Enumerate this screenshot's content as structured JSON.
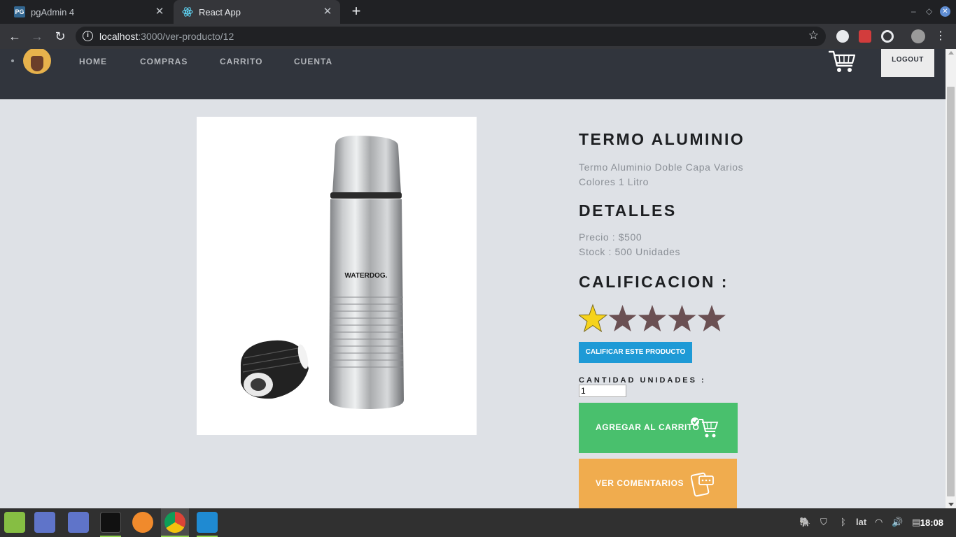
{
  "browser": {
    "tabs": [
      {
        "title": "pgAdmin 4",
        "favicon": "PG"
      },
      {
        "title": "React App",
        "favicon": "react-icon"
      }
    ],
    "new_tab": "+",
    "url_host": "localhost",
    "url_rest": ":3000/ver-producto/12"
  },
  "nav": {
    "links": [
      "HOME",
      "COMPRAS",
      "CARRITO",
      "CUENTA"
    ],
    "logout": "LOGOUT"
  },
  "product": {
    "title": "TERMO ALUMINIO",
    "description": "Termo Aluminio Doble Capa Varios Colores 1 Litro",
    "details_heading": "DETALLES",
    "price": "Precio : $500",
    "stock": "Stock : 500 Unidades",
    "rating_heading": "CALIFICACION :",
    "rating": 1,
    "rating_max": 5,
    "rate_button": "CALIFICAR ESTE PRODUCTO",
    "quantity_label": "CANTIDAD UNIDADES :",
    "quantity_value": "1",
    "add_to_cart": "AGREGAR AL CARRITO",
    "view_comments": "VER COMENTARIOS",
    "image_brand": "WATERDOG."
  },
  "taskbar": {
    "keyboard_layout": "lat",
    "clock": "18:08"
  },
  "colors": {
    "nav_bg": "#31353d",
    "page_bg": "#dee1e6",
    "rate_button": "#1e9ad6",
    "add_button": "#49c06d",
    "comments_button": "#f0ac4e",
    "star_filled": "#f6d31c",
    "star_empty": "#6b5053"
  }
}
